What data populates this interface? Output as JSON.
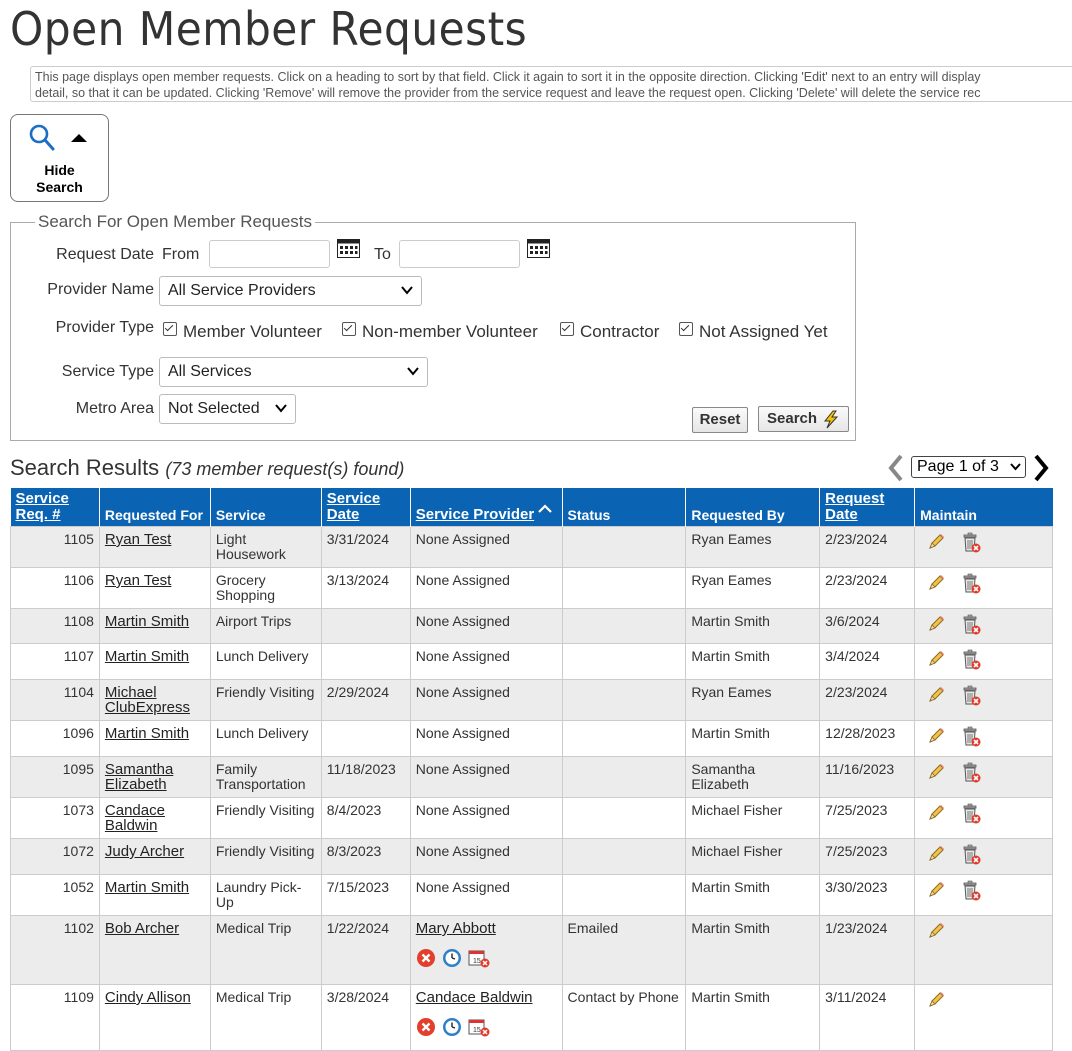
{
  "page": {
    "title": "Open Member Requests",
    "info": "This page displays open member requests. Click on a heading to sort by that field. Click it again to sort it in the opposite direction. Clicking 'Edit' next to an entry will display",
    "info2": "detail, so that it can be updated. Clicking 'Remove' will remove the provider from the service request and leave the request open. Clicking 'Delete' will delete the service rec"
  },
  "hide_search": {
    "label_line1": "Hide",
    "label_line2": "Search"
  },
  "search": {
    "legend": "Search For Open Member Requests",
    "request_date_label": "Request Date",
    "from_label": "From",
    "to_label": "To",
    "from_value": "",
    "to_value": "",
    "provider_name_label": "Provider Name",
    "provider_name_value": "All Service Providers",
    "provider_type_label": "Provider Type",
    "provider_types": [
      "Member Volunteer",
      "Non-member Volunteer",
      "Contractor",
      "Not Assigned Yet"
    ],
    "service_type_label": "Service Type",
    "service_type_value": "All Services",
    "metro_area_label": "Metro Area",
    "metro_area_value": "Not Selected",
    "reset_label": "Reset",
    "search_label": "Search"
  },
  "results": {
    "heading": "Search Results",
    "count_text": "(73 member request(s) found)",
    "page_select": "Page 1 of 3"
  },
  "table": {
    "headers": {
      "req": "Service Req. #",
      "for": "Requested For",
      "service": "Service",
      "date": "Service Date",
      "provider": "Service Provider",
      "status": "Status",
      "by": "Requested By",
      "reqdate": "Request Date",
      "maintain": "Maintain"
    },
    "rows": [
      {
        "req": "1105",
        "for": "Ryan Test",
        "service": "Light Housework",
        "date": "3/31/2024",
        "provider": "None Assigned",
        "status": "",
        "by": "Ryan Eames",
        "reqdate": "2/23/2024"
      },
      {
        "req": "1106",
        "for": "Ryan Test",
        "service": "Grocery Shopping",
        "date": "3/13/2024",
        "provider": "None Assigned",
        "status": "",
        "by": "Ryan Eames",
        "reqdate": "2/23/2024"
      },
      {
        "req": "1108",
        "for": "Martin Smith",
        "service": "Airport Trips",
        "date": "",
        "provider": "None Assigned",
        "status": "",
        "by": "Martin Smith",
        "reqdate": "3/6/2024"
      },
      {
        "req": "1107",
        "for": "Martin Smith",
        "service": "Lunch Delivery",
        "date": "",
        "provider": "None Assigned",
        "status": "",
        "by": "Martin Smith",
        "reqdate": "3/4/2024"
      },
      {
        "req": "1104",
        "for": "Michael ClubExpress",
        "service": "Friendly Visiting",
        "date": "2/29/2024",
        "provider": "None Assigned",
        "status": "",
        "by": "Ryan Eames",
        "reqdate": "2/23/2024"
      },
      {
        "req": "1096",
        "for": "Martin Smith",
        "service": "Lunch Delivery",
        "date": "",
        "provider": "None Assigned",
        "status": "",
        "by": "Martin Smith",
        "reqdate": "12/28/2023"
      },
      {
        "req": "1095",
        "for": "Samantha Elizabeth",
        "service": "Family Transportation",
        "date": "11/18/2023",
        "provider": "None Assigned",
        "status": "",
        "by": "Samantha Elizabeth",
        "reqdate": "11/16/2023"
      },
      {
        "req": "1073",
        "for": "Candace Baldwin",
        "service": "Friendly Visiting",
        "date": "8/4/2023",
        "provider": "None Assigned",
        "status": "",
        "by": "Michael Fisher",
        "reqdate": "7/25/2023"
      },
      {
        "req": "1072",
        "for": "Judy Archer",
        "service": "Friendly Visiting",
        "date": "8/3/2023",
        "provider": "None Assigned",
        "status": "",
        "by": "Michael Fisher",
        "reqdate": "7/25/2023"
      },
      {
        "req": "1052",
        "for": "Martin Smith",
        "service": "Laundry Pick-Up",
        "date": "7/15/2023",
        "provider": "None Assigned",
        "status": "",
        "by": "Martin Smith",
        "reqdate": "3/30/2023"
      },
      {
        "req": "1102",
        "for": "Bob Archer",
        "service": "Medical Trip",
        "date": "1/22/2024",
        "provider": "Mary Abbott",
        "status": "Emailed",
        "by": "Martin Smith",
        "reqdate": "1/23/2024"
      },
      {
        "req": "1109",
        "for": "Cindy Allison",
        "service": "Medical Trip",
        "date": "3/28/2024",
        "provider": "Candace Baldwin",
        "status": "Contact by Phone",
        "by": "Martin Smith",
        "reqdate": "3/11/2024"
      }
    ]
  },
  "colors": {
    "header_blue": "#0a64b3",
    "row_alt": "#ececec"
  }
}
